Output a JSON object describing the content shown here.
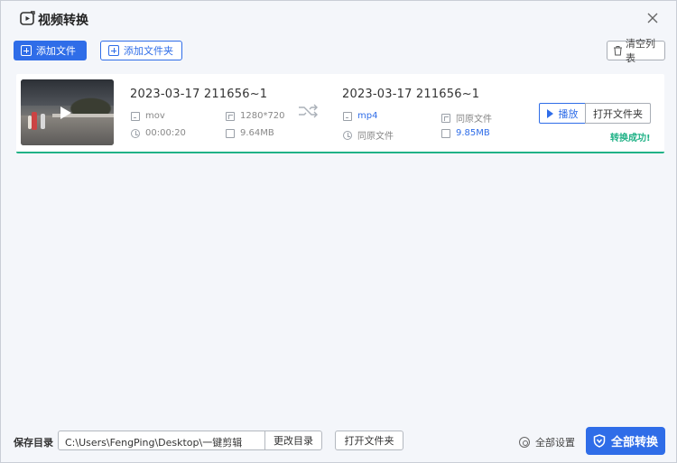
{
  "app": {
    "title": "视频转换"
  },
  "toolbar": {
    "add_file": "添加文件",
    "add_folder": "添加文件夹",
    "clear_list": "清空列表"
  },
  "file": {
    "source": {
      "name": "2023-03-17 211656~1",
      "format": "mov",
      "resolution": "1280*720",
      "duration": "00:00:20",
      "size": "9.64MB"
    },
    "target": {
      "name": "2023-03-17 211656~1",
      "format": "mp4",
      "resolution": "同原文件",
      "duration": "同原文件",
      "size": "9.85MB"
    },
    "play_label": "播放",
    "open_folder_label": "打开文件夹",
    "status": "转换成功!",
    "status_color": "#21b287"
  },
  "bottom": {
    "save_dir_label": "保存目录",
    "save_path": "C:\\Users\\FengPing\\Desktop\\一键剪辑",
    "change_dir": "更改目录",
    "open_dir": "打开文件夹",
    "settings": "全部设置",
    "convert_all": "全部转换"
  },
  "colors": {
    "accent": "#2f6de8",
    "success": "#21b287"
  },
  "icons": {
    "app": "video-convert-icon",
    "close": "close-icon",
    "clear": "trash-icon",
    "shuffle": "convert-arrows-icon",
    "settings": "gear-icon",
    "convert": "shield-icon"
  }
}
